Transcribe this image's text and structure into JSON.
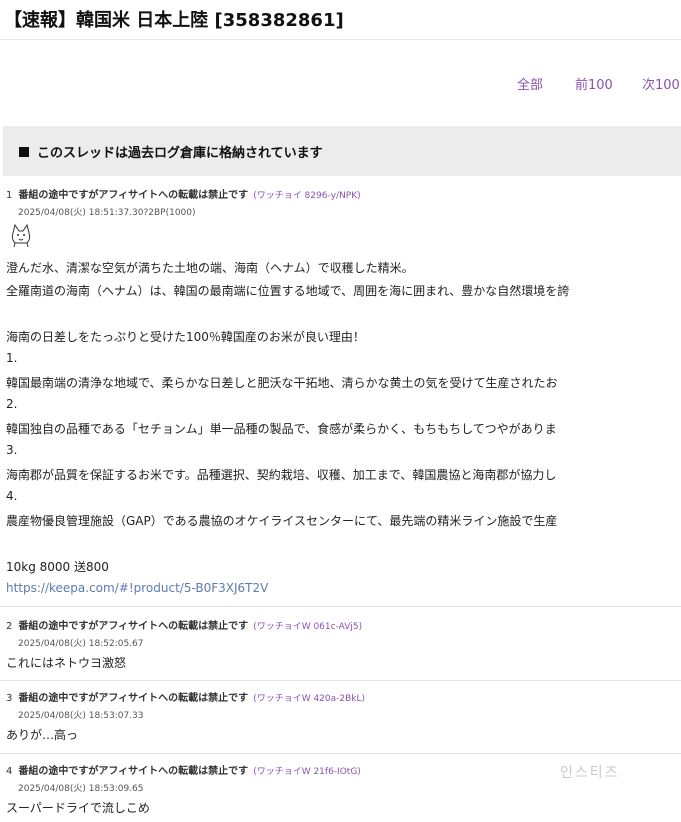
{
  "thread": {
    "title": "【速報】韓国米 日本上陸 [358382861]"
  },
  "nav": {
    "all": "全部",
    "prev": "前100",
    "next": "次100"
  },
  "archive_notice": "このスレッドは過去ログ倉庫に格納されています",
  "posts": [
    {
      "num": "1",
      "name": "番組の途中ですがアフィサイトへの転載は禁止です",
      "id": "(ワッチョイ 8296-y/NPK)",
      "date": "2025/04/08(火) 18:51:37.30?2BP(1000)",
      "icon": "ascii-cat-icon",
      "lines": [
        "澄んだ水、清潔な空気が満ちた土地の端、海南（ヘナム）で収穫した精米。",
        "全羅南道の海南（ヘナム）は、韓国の最南端に位置する地域で、周囲を海に囲まれ、豊かな自然環境を誇",
        "",
        "海南の日差しをたっぷりと受けた100％韓国産のお米が良い理由！",
        "1.",
        "韓国最南端の清浄な地域で、柔らかな日差しと肥沃な干拓地、清らかな黄土の気を受けて生産されたお",
        "2.",
        "韓国独自の品種である「セチョンム」単一品種の製品で、食感が柔らかく、もちもちしてつやがありま",
        "3.",
        "海南郡が品質を保証するお米です。品種選択、契約栽培、収穫、加工まで、韓国農協と海南郡が協力し",
        "4.",
        "農産物優良管理施設（GAP）である農協のオケイライスセンターにて、最先端の精米ライン施設で生産",
        "",
        "10kg 8000 送800"
      ],
      "link": "https://keepa.com/#!product/5-B0F3XJ6T2V"
    },
    {
      "num": "2",
      "name": "番組の途中ですがアフィサイトへの転載は禁止です",
      "id": "(ワッチョイW 061c-AVj5)",
      "date": "2025/04/08(火) 18:52:05.67",
      "lines": [
        "これにはネトウヨ激怒"
      ]
    },
    {
      "num": "3",
      "name": "番組の途中ですがアフィサイトへの転載は禁止です",
      "id": "(ワッチョイW 420a-2BkL)",
      "date": "2025/04/08(火) 18:53:07.33",
      "lines": [
        "ありが…高っ"
      ]
    },
    {
      "num": "4",
      "name": "番組の途中ですがアフィサイトへの転載は禁止です",
      "id": "(ワッチョイW 21f6-IOtG)",
      "date": "2025/04/08(火) 18:53:09.65",
      "lines": [
        "スーパードライで流しこめ"
      ]
    }
  ],
  "watermark": "인스티즈",
  "colors": {
    "link": "#8a52b3",
    "url": "#5b7bb0",
    "notice_bg": "#ececec"
  }
}
